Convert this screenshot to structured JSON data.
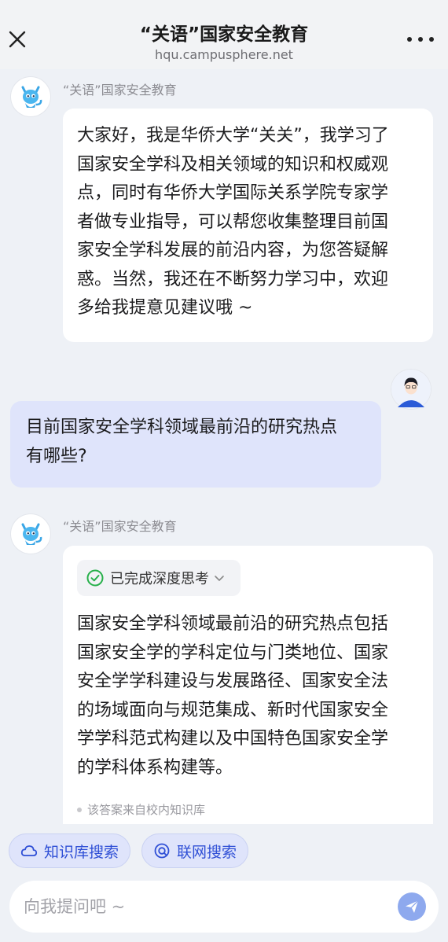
{
  "header": {
    "title": "“关语”国家安全教育",
    "subtitle": "hqu.campusphere.net",
    "close_icon": "close-icon",
    "more_icon": "more-dots-icon"
  },
  "messages": {
    "bot1": {
      "sender": "“关语”国家安全教育",
      "lines": [
        "大家好，我是华侨大学“关关”，我学习了",
        "国家安全学科及相关领域的知识和权威观",
        "点，同时有华侨大学国际关系学院专家学",
        "者做专业指导，可以帮您收集整理目前国",
        "家安全学科发展的前沿内容，为您答疑解",
        "惑。当然，我还在不断努力学习中，欢迎",
        "多给我提意见建议哦 ~"
      ]
    },
    "user1": {
      "lines": [
        "目前国家安全学科领域最前沿的研究热点",
        "有哪些?"
      ]
    },
    "bot2": {
      "sender": "“关语”国家安全教育",
      "think_label": "已完成深度思考",
      "lines": [
        "国家安全学科领域最前沿的研究热点包括",
        "国家安全学的学科定位与门类地位、国家",
        "安全学学科建设与发展路径、国家安全法",
        "的场域面向与规范集成、新时代国家安全",
        "学学科范式构建以及中国特色国家安全学",
        "的学科体系构建等。"
      ],
      "source_note": "该答案来自校内知识库"
    }
  },
  "bottom": {
    "chip_kb": "知识库搜索",
    "chip_web": "联网搜索",
    "input_placeholder": "向我提问吧 ~"
  },
  "colors": {
    "accent": "#2f4fd6",
    "user_bubble": "#dfe4fb",
    "background": "#eef1f6",
    "check_green": "#27b04a",
    "send_button": "#8ea9ee"
  }
}
